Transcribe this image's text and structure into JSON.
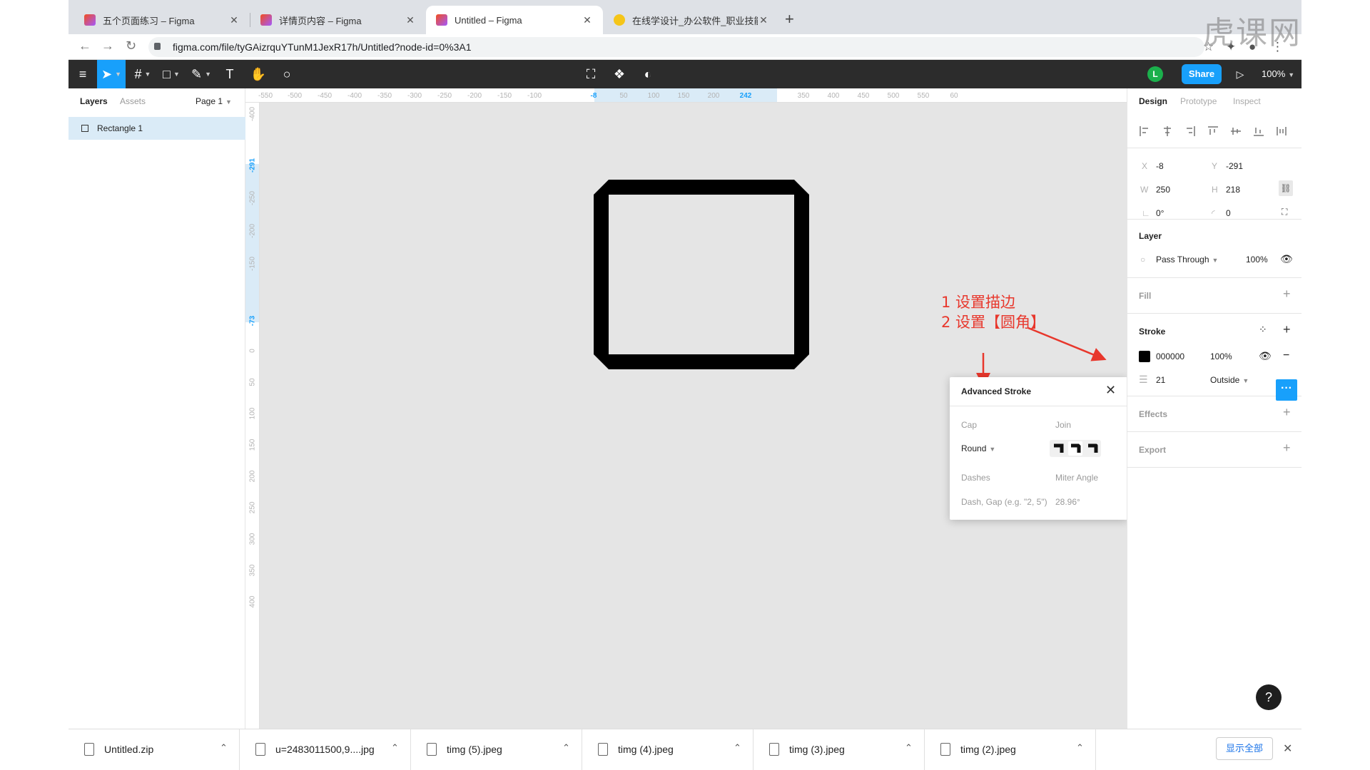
{
  "browser": {
    "tabs": [
      {
        "title": "五个页面练习 – Figma",
        "active": false
      },
      {
        "title": "详情页内容 – Figma",
        "active": false
      },
      {
        "title": "Untitled – Figma",
        "active": true
      },
      {
        "title": "在线学设计_办公软件_职业技能",
        "active": false
      }
    ],
    "url": "figma.com/file/tyGAizrquYTunM1JexR17h/Untitled?node-id=0%3A1",
    "watermark": "虎课网"
  },
  "toolbar": {
    "avatar_letter": "L",
    "share_label": "Share",
    "zoom": "100%"
  },
  "left_panel": {
    "tabs": [
      "Layers",
      "Assets"
    ],
    "page": "Page 1",
    "layers": [
      "Rectangle 1"
    ]
  },
  "rulers": {
    "top": [
      "-550",
      "-500",
      "-450",
      "-400",
      "-350",
      "-300",
      "-250",
      "-200",
      "-150",
      "-100",
      "-8",
      "50",
      "100",
      "150",
      "200",
      "242",
      "350",
      "400",
      "450",
      "500",
      "550",
      "60"
    ],
    "left": [
      "-400",
      "-291",
      "-250",
      "-200",
      "-150",
      "-73",
      "0",
      "50",
      "100",
      "150",
      "200",
      "250",
      "300",
      "350",
      "400"
    ]
  },
  "annotation": {
    "line1": "1 设置描边",
    "line2": "2 设置【圆角】"
  },
  "advanced_stroke": {
    "title": "Advanced Stroke",
    "cap_label": "Cap",
    "cap_value": "Round",
    "join_label": "Join",
    "dashes_label": "Dashes",
    "dashes_placeholder": "Dash, Gap (e.g. \"2, 5\")",
    "miter_label": "Miter Angle",
    "miter_value": "28.96°"
  },
  "right_panel": {
    "tabs": [
      "Design",
      "Prototype",
      "Inspect"
    ],
    "props": {
      "x_label": "X",
      "x": "-8",
      "y_label": "Y",
      "y": "-291",
      "w_label": "W",
      "w": "250",
      "h_label": "H",
      "h": "218",
      "rotation": "0°",
      "radius": "0"
    },
    "layer": {
      "title": "Layer",
      "blend": "Pass Through",
      "opacity": "100%"
    },
    "fill": {
      "title": "Fill"
    },
    "stroke": {
      "title": "Stroke",
      "color": "000000",
      "opacity": "100%",
      "weight": "21",
      "position": "Outside"
    },
    "effects": {
      "title": "Effects"
    },
    "export": {
      "title": "Export"
    }
  },
  "help_label": "?",
  "downloads": {
    "items": [
      "Untitled.zip",
      "u=2483011500,9....jpg",
      "timg (5).jpeg",
      "timg (4).jpeg",
      "timg (3).jpeg",
      "timg (2).jpeg"
    ],
    "show_all": "显示全部"
  },
  "colors": {
    "accent": "#18a0fb",
    "toolbar_bg": "#2c2c2c",
    "canvas_bg": "#e5e5e5",
    "annotation": "#e8372c",
    "layer_selected": "#daebf7"
  }
}
